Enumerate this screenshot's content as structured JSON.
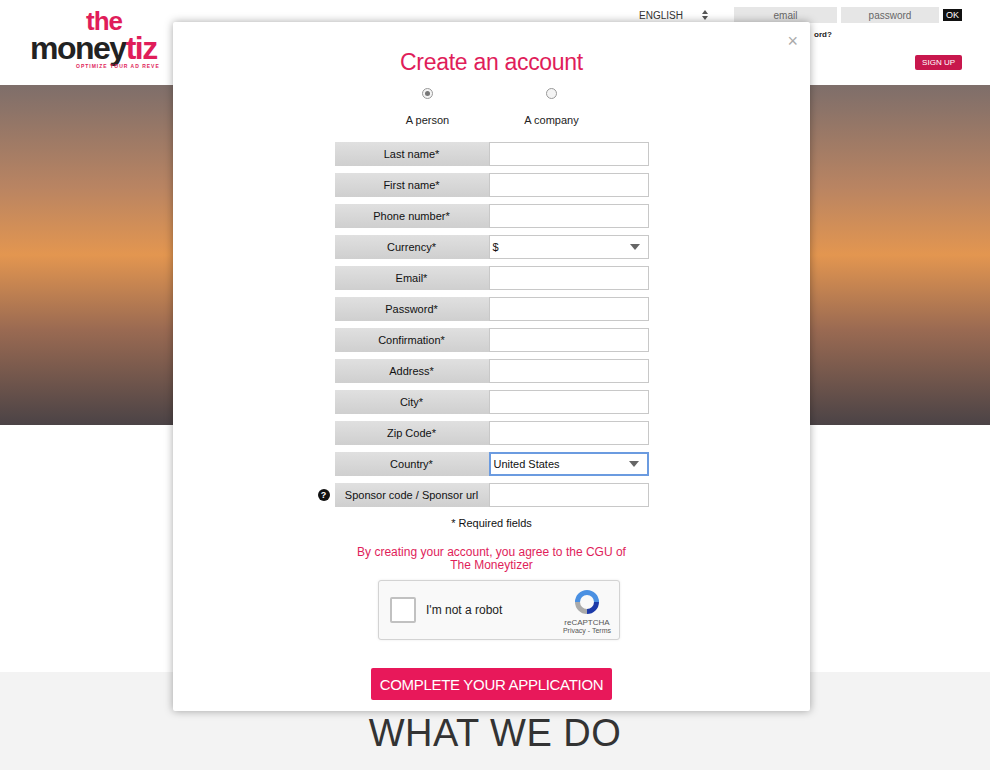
{
  "header": {
    "logo": {
      "top": "the",
      "parts": [
        {
          "text": "money",
          "color": "#222222"
        },
        {
          "text": "tiz",
          "color": "#e01d5a"
        }
      ],
      "tagline": "OPTIMIZE YOUR AD REVE"
    },
    "language": "ENGLISH",
    "login": {
      "email_placeholder": "email",
      "password_placeholder": "password",
      "button": "OK",
      "forgot": "ord?"
    },
    "signup": "SIGN UP"
  },
  "hero": {},
  "modal": {
    "title": "Create an account",
    "close": "×",
    "account_types": [
      {
        "label": "A person",
        "selected": true
      },
      {
        "label": "A company",
        "selected": false
      }
    ],
    "fields": [
      {
        "label": "Last name*",
        "kind": "text",
        "value": "",
        "focused": false,
        "help": ""
      },
      {
        "label": "First name*",
        "kind": "text",
        "value": "",
        "focused": false,
        "help": ""
      },
      {
        "label": "Phone number*",
        "kind": "text",
        "value": "",
        "focused": false,
        "help": ""
      },
      {
        "label": "Currency*",
        "kind": "select",
        "value": "$",
        "focused": false,
        "help": ""
      },
      {
        "label": "Email*",
        "kind": "text",
        "value": "",
        "focused": false,
        "help": ""
      },
      {
        "label": "Password*",
        "kind": "text",
        "value": "",
        "focused": false,
        "help": ""
      },
      {
        "label": "Confirmation*",
        "kind": "text",
        "value": "",
        "focused": false,
        "help": ""
      },
      {
        "label": "Address*",
        "kind": "text",
        "value": "",
        "focused": false,
        "help": ""
      },
      {
        "label": "City*",
        "kind": "text",
        "value": "",
        "focused": false,
        "help": ""
      },
      {
        "label": "Zip Code*",
        "kind": "text",
        "value": "",
        "focused": false,
        "help": ""
      },
      {
        "label": "Country*",
        "kind": "select",
        "value": "United States",
        "focused": true,
        "help": ""
      },
      {
        "label": "Sponsor code / Sponsor url",
        "kind": "text",
        "value": "",
        "focused": false,
        "help": "?"
      }
    ],
    "required_note": "* Required fields",
    "terms": "By creating your account, you agree to the CGU of The Moneytizer",
    "captcha": {
      "label": "I'm not a robot",
      "brand": "reCAPTCHA",
      "links": "Privacy - Terms",
      "checked": false
    },
    "submit": "COMPLETE YOUR APPLICATION"
  },
  "section": {
    "heading": "WHAT WE DO"
  }
}
